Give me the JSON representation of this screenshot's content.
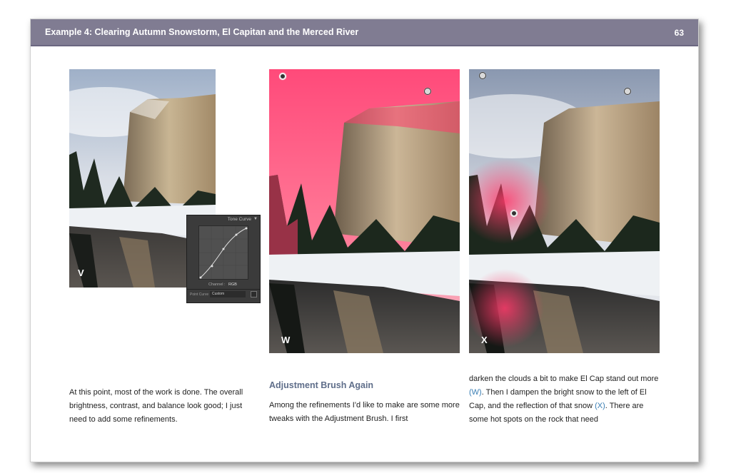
{
  "header": {
    "title": "Example 4: Clearing Autumn Snowstorm, El Capitan and the Merced River",
    "page_number": "63"
  },
  "photos": [
    {
      "label": "V"
    },
    {
      "label": "W"
    },
    {
      "label": "X"
    }
  ],
  "tone_curve": {
    "title": "Tone Curve",
    "channel_label": "Channel :",
    "channel_value": "RGB",
    "point_curve_label": "Point Curve :",
    "point_curve_value": "Custom"
  },
  "column1": {
    "text": "At this point, most of the work is done. The overall brightness, contrast, and balance look good; I just need to add some refinements."
  },
  "column2": {
    "heading": "Adjustment Brush Again",
    "text": "Among the refinements I'd like to make are some more tweaks with the Adjustment Brush. I first"
  },
  "column3": {
    "part1": "darken the clouds a bit to make El Cap stand out more",
    "ref1": "(W)",
    "part2": ". Then I dampen the bright snow to the left of El Cap, and the reflection of that snow",
    "ref2": "(X)",
    "part3": ". There are some hot spots on the rock that need"
  },
  "colors": {
    "header_bg": "#807c92",
    "heading_text": "#5f6e8a",
    "link": "#3b7fb5",
    "mask_overlay": "#ff3a6a"
  }
}
